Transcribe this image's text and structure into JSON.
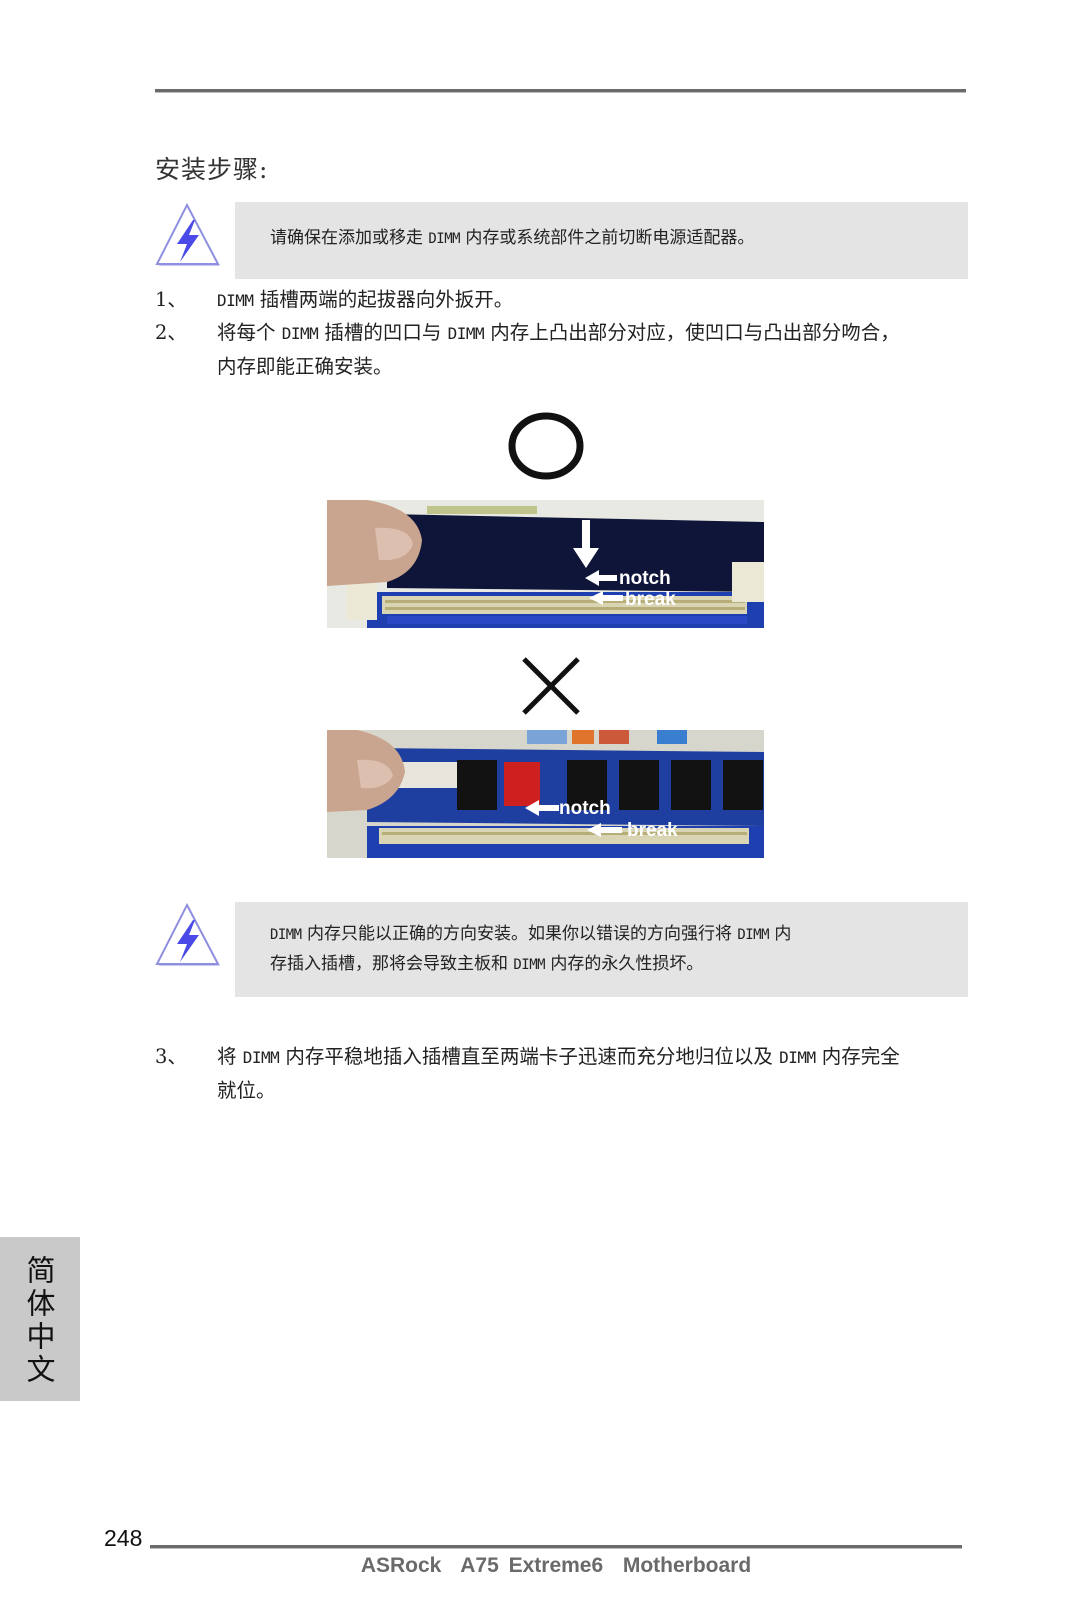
{
  "section_title": "安装步骤:",
  "warnings": [
    {
      "icon": "warning-lightning-icon",
      "lines": [
        {
          "before": "请确保在添加或移走 ",
          "code": "DIMM",
          "after": " 内存或系统部件之前切断电源适配器。"
        }
      ]
    },
    {
      "icon": "warning-lightning-icon",
      "lines": [
        {
          "before": "",
          "code": "DIMM",
          "after": " 内存只能以正确的方向安装。如果你以错误的方向强行将 ",
          "code2": "DIMM",
          "after2": " 内"
        },
        {
          "before": "存插入插槽，那将会导致主板和 ",
          "code": "DIMM",
          "after": " 内存的永久性损坏。"
        }
      ]
    }
  ],
  "steps": [
    {
      "num": "1、",
      "parts": [
        {
          "code": "DIMM"
        },
        {
          "text": " 插槽两端的起拔器向外扳开。"
        }
      ]
    },
    {
      "num": "2、",
      "parts": [
        {
          "text": "将每个 "
        },
        {
          "code": "DIMM"
        },
        {
          "text": " 插槽的凹口与 "
        },
        {
          "code": "DIMM"
        },
        {
          "text": " 内存上凸出部分对应，使凹口与凸出部分吻合，内存即能正确安装。"
        }
      ]
    },
    {
      "num": "3、",
      "parts": [
        {
          "text": "将 "
        },
        {
          "code": "DIMM"
        },
        {
          "text": " 内存平稳地插入插槽直至两端卡子迅速而充分地归位以及 "
        },
        {
          "code": "DIMM"
        },
        {
          "text": " 内存完全就位。"
        }
      ]
    }
  ],
  "figures": {
    "correct_symbol": "correct-circle-icon",
    "wrong_symbol": "wrong-cross-icon",
    "photo_correct": {
      "notch_label": "notch",
      "break_label": "break"
    },
    "photo_wrong": {
      "notch_label": "notch",
      "break_label": "break"
    }
  },
  "side_tab": {
    "label": "简体中文"
  },
  "footer": {
    "page_number": "248",
    "brand": "ASRock  A75 Extreme6  Motherboard"
  },
  "colors": {
    "warn_box": "#e4e4e4",
    "side_tab": "#c9c9c9",
    "rule": "#6b6b6b",
    "footer_text": "#6a6a6a",
    "icon_bolt": "#4a4ae8",
    "icon_outline": "#8f8fe0"
  }
}
